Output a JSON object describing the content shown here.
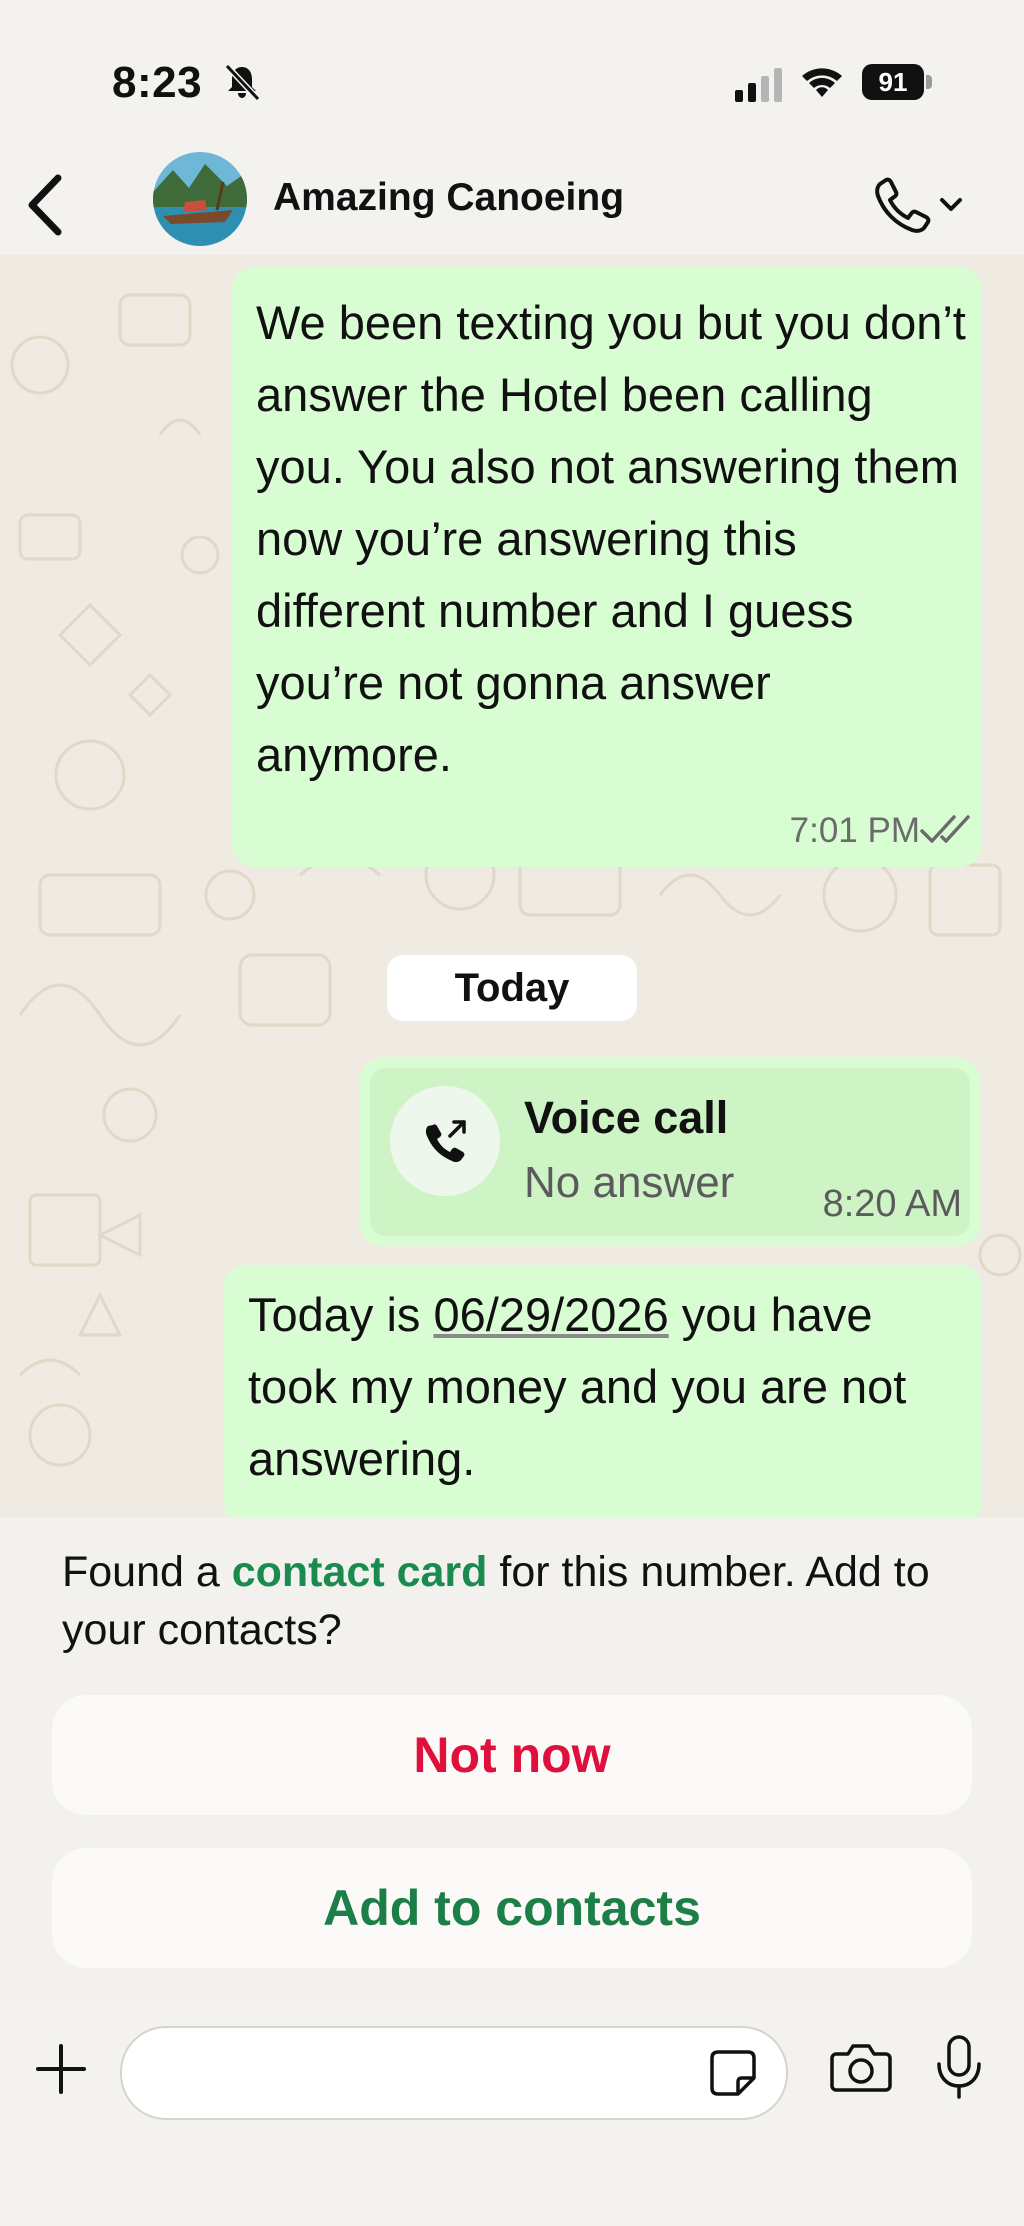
{
  "status_bar": {
    "time": "8:23",
    "battery": "91"
  },
  "header": {
    "contact_name": "Amazing Canoeing",
    "back_icon": "chevron-left-icon",
    "call_icon": "phone-icon"
  },
  "messages": [
    {
      "text": "We been texting you but you don’t answer the Hotel been calling you. You also not answering them now you’re answering this different number and I guess you’re not gonna answer anymore.",
      "time": "7:01 PM",
      "status": "read"
    }
  ],
  "day_separator": "Today",
  "voice_call": {
    "title": "Voice call",
    "subtitle": "No answer",
    "time": "8:20 AM"
  },
  "message2": {
    "before": "Today is ",
    "date": "06/29/2026",
    "after": " you have took my money and you are not answering."
  },
  "contact_prompt": {
    "text_before": "Found a ",
    "link": "contact card",
    "text_after": " for this number. Add to your contacts?",
    "not_now": "Not now",
    "add": "Add to contacts"
  },
  "composer": {
    "placeholder": ""
  },
  "colors": {
    "bubble": "#d9fdd3",
    "accent_green": "#1d7f48",
    "danger": "#e0103c"
  }
}
